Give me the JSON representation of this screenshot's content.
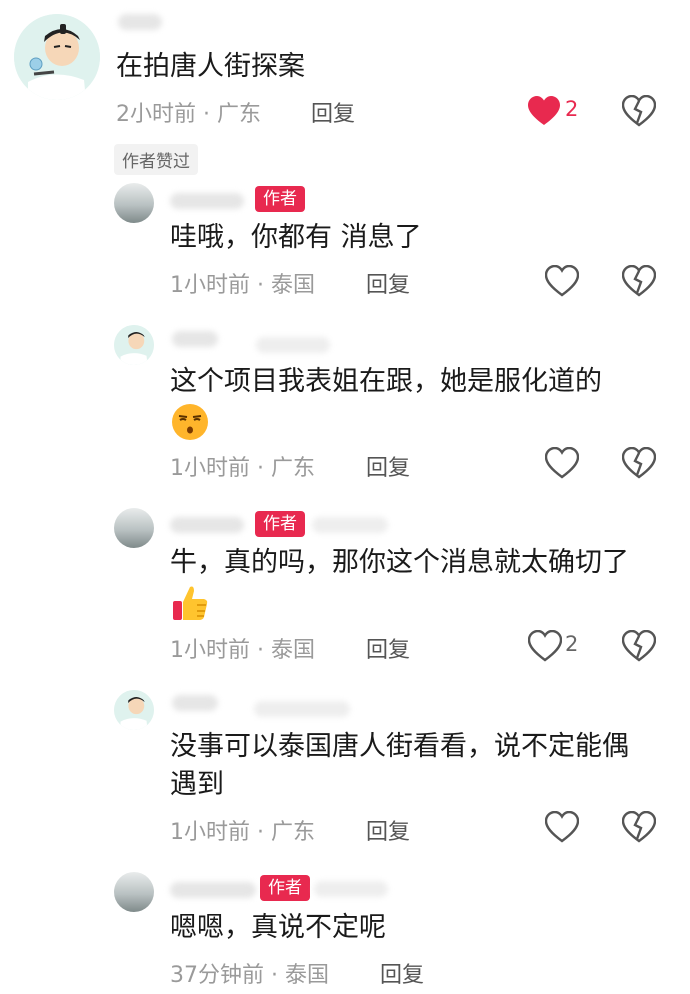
{
  "top": {
    "text": "在拍唐人街探案",
    "time": "2小时前",
    "sep": "·",
    "location": "广东",
    "reply": "回复",
    "likes": "2",
    "author_liked": "作者赞过"
  },
  "replies": [
    {
      "badge": "作者",
      "text": "哇哦，你都有 消息了",
      "time": "1小时前",
      "location": "泰国",
      "reply": "回复"
    },
    {
      "text_line1": "这个项目我表姐在跟，她是服化道的",
      "time": "1小时前",
      "location": "广东",
      "reply": "回复"
    },
    {
      "badge": "作者",
      "text_line1": "牛，真的吗，那你这个消息就太确切了",
      "time": "1小时前",
      "location": "泰国",
      "reply": "回复",
      "likes": "2"
    },
    {
      "text_line1": "没事可以泰国唐人街看看，说不定能偶",
      "text_line2": "遇到",
      "time": "1小时前",
      "location": "广东",
      "reply": "回复"
    },
    {
      "badge": "作者",
      "text": "嗯嗯，真说不定呢",
      "time": "37分钟前",
      "location": "泰国",
      "reply": "回复"
    }
  ],
  "colors": {
    "accent": "#e8294f",
    "meta": "#9a9a9a"
  },
  "icons": [
    "like-heart-icon",
    "dislike-broken-heart-icon"
  ]
}
